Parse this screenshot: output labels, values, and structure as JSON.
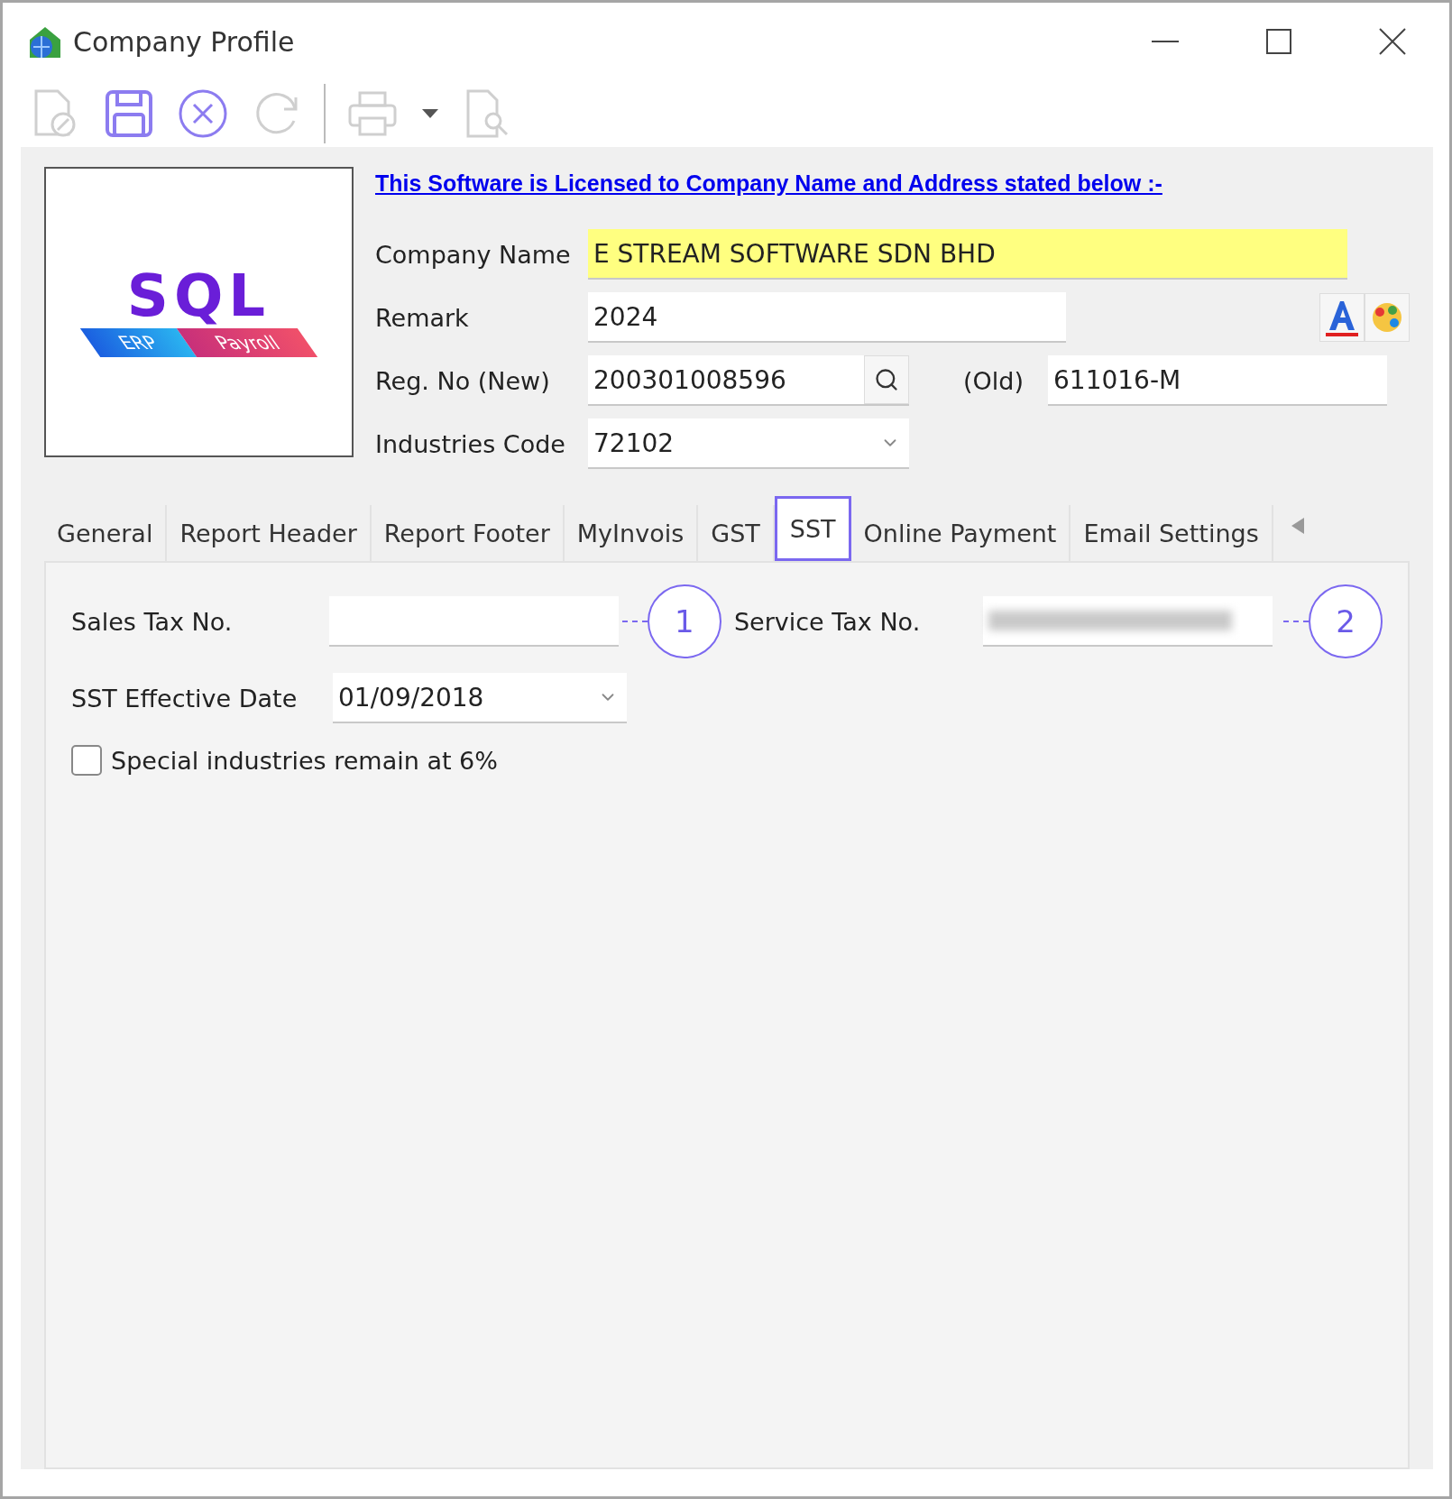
{
  "window": {
    "title": "Company Profile"
  },
  "toolbar": [
    {
      "kind": "new",
      "disabled": true
    },
    {
      "kind": "save",
      "disabled": false
    },
    {
      "kind": "cancel",
      "disabled": false
    },
    {
      "kind": "refresh",
      "disabled": true
    },
    {
      "kind": "print",
      "disabled": true
    },
    {
      "kind": "dropdown",
      "disabled": false
    },
    {
      "kind": "preview",
      "disabled": true
    }
  ],
  "logo": {
    "title": "SQL",
    "tags": [
      "ERP",
      "Payroll"
    ]
  },
  "license_notice": "This Software is Licensed to Company Name and Address stated below :-",
  "company_name": {
    "label": "Company Name",
    "value": "E STREAM SOFTWARE SDN BHD"
  },
  "remark": {
    "label": "Remark",
    "value": "2024"
  },
  "reg_no_new": {
    "label": "Reg. No (New)",
    "value": "200301008596"
  },
  "reg_no_old": {
    "label": "(Old)",
    "value": "611016-M"
  },
  "industries_code": {
    "label": "Industries Code",
    "value": "72102"
  },
  "tabs": [
    {
      "label": "General",
      "selected": false
    },
    {
      "label": "Report Header",
      "selected": false
    },
    {
      "label": "Report Footer",
      "selected": false
    },
    {
      "label": "MyInvois",
      "selected": false
    },
    {
      "label": "GST",
      "selected": false
    },
    {
      "label": "SST",
      "selected": true
    },
    {
      "label": "Online Payment",
      "selected": false
    },
    {
      "label": "Email Settings",
      "selected": false
    }
  ],
  "sst": {
    "sales_tax_no": {
      "label": "Sales Tax No.",
      "callout": "1"
    },
    "service_tax_no": {
      "label": "Service Tax No.",
      "callout": "2"
    },
    "effective_date": {
      "label": "SST Effective Date",
      "value": "01/09/2018"
    },
    "special_industries": {
      "label": "Special industries remain at 6%",
      "checked": false
    }
  }
}
